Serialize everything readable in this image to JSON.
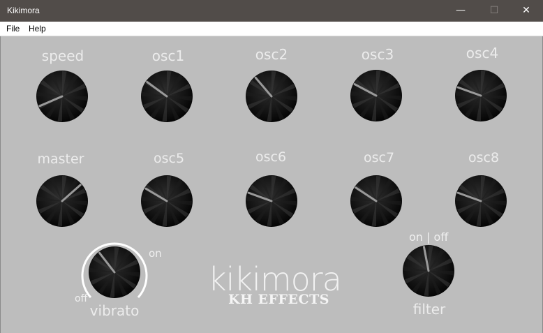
{
  "window": {
    "title": "Kikimora",
    "minimize": "—",
    "maximize": "☐",
    "close": "✕"
  },
  "menu": {
    "file": "File",
    "help": "Help"
  },
  "knobs_row1": [
    {
      "label": "speed",
      "value": 0.08
    },
    {
      "label": "osc1",
      "value": 0.3
    },
    {
      "label": "osc2",
      "value": 0.35
    },
    {
      "label": "osc3",
      "value": 0.27
    },
    {
      "label": "osc4",
      "value": 0.24
    }
  ],
  "knobs_row2": [
    {
      "label": "master",
      "value": 0.68
    },
    {
      "label": "osc5",
      "value": 0.28
    },
    {
      "label": "osc6",
      "value": 0.24
    },
    {
      "label": "osc7",
      "value": 0.29
    },
    {
      "label": "osc8",
      "value": 0.24
    }
  ],
  "vibrato": {
    "label": "vibrato",
    "on_label": "on",
    "off_label": "off",
    "value": 0.36
  },
  "filter": {
    "label": "filter",
    "switch_label": "on | off",
    "value": 0.46
  },
  "brand": {
    "name": "kikimora",
    "maker": "KH EFFECTS"
  },
  "colors": {
    "background": "#bdbdbd",
    "titlebar": "#514c49",
    "label": "#ececec",
    "knob": "#141414",
    "pointer": "#9a9a9a"
  }
}
